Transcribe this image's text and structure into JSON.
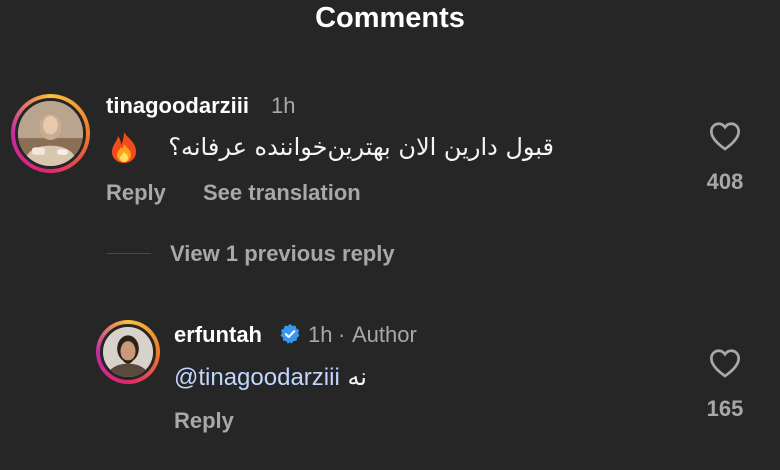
{
  "header": {
    "title": "Comments"
  },
  "comments": [
    {
      "username": "tinagoodarziii",
      "time": "1h",
      "text": "قبول دارین الان بهترین‌خواننده عرفانه؟",
      "emoji_icon": "fire-icon",
      "reply_label": "Reply",
      "translate_label": "See translation",
      "likes": "408"
    }
  ],
  "replies_toggle": {
    "label": "View 1 previous reply"
  },
  "replies": [
    {
      "username": "erfuntah",
      "verified_icon": "verified-badge-icon",
      "time": "1h",
      "separator": "·",
      "author_label": "Author",
      "mention": "@tinagoodarziii",
      "text": "نه",
      "reply_label": "Reply",
      "likes": "165"
    }
  ],
  "colors": {
    "background": "#262626",
    "text": "#f5f5f5",
    "secondary": "#a8a8a8",
    "mention": "#c1d6ff",
    "verified": "#3897f0"
  }
}
